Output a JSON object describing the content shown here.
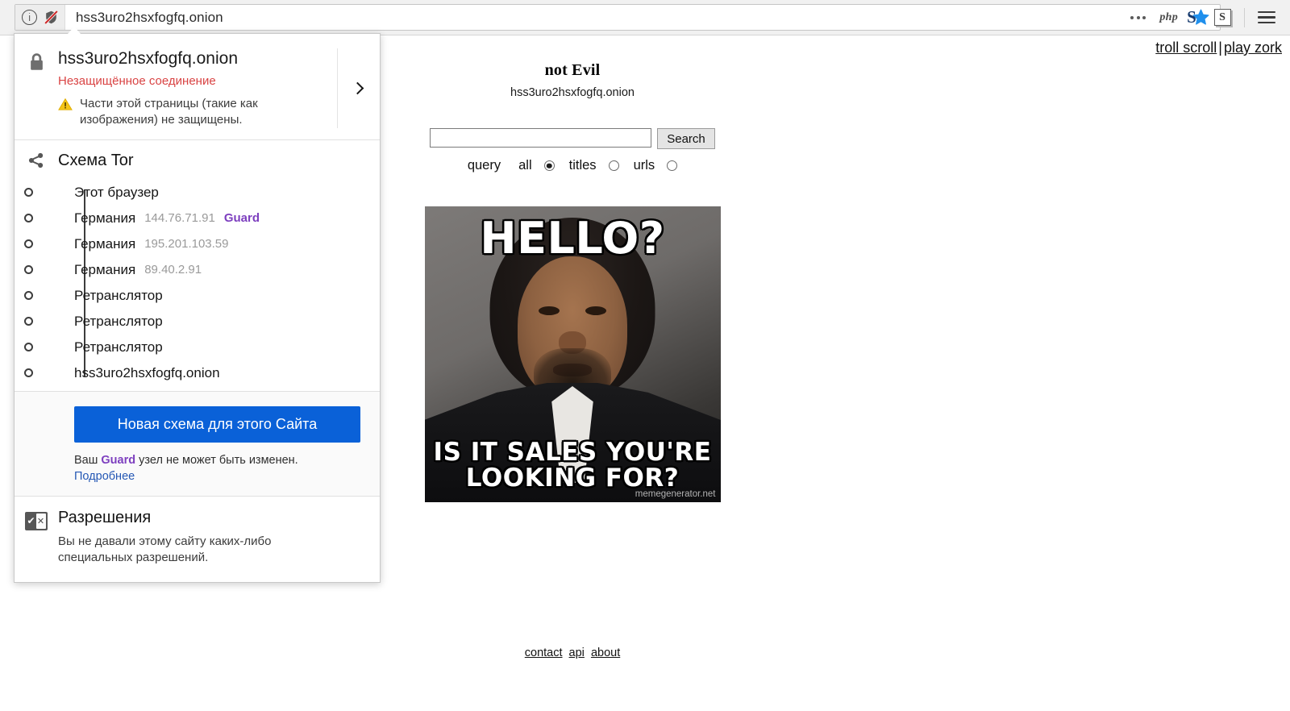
{
  "browser": {
    "url": "hss3uro2hsxfogfq.onion",
    "identity_icon": "info-circle-icon",
    "mixed_content_icon": "shield-slash-icon",
    "overflow_icon": "ellipsis-icon",
    "php_addon_label": "php",
    "bookmark_icon": "star-icon",
    "extension_1_label": "S",
    "extension_2_label": "S",
    "menu_icon": "hamburger-menu-icon"
  },
  "identity_popup": {
    "host": "hss3uro2hsxfogfq.onion",
    "connection_status": "Незащищённое соединение",
    "warning_text": "Части этой страницы (такие как изображения) не защищены.",
    "lock_icon": "lock-icon",
    "warning_icon": "warning-triangle-icon",
    "expand_icon": "chevron-right-icon",
    "tor": {
      "title": "Схема Tor",
      "icon": "share-nodes-icon",
      "nodes": [
        {
          "name": "Этот браузер",
          "ip": "",
          "badge": ""
        },
        {
          "name": "Германия",
          "ip": "144.76.71.91",
          "badge": "Guard"
        },
        {
          "name": "Германия",
          "ip": "195.201.103.59",
          "badge": ""
        },
        {
          "name": "Германия",
          "ip": "89.40.2.91",
          "badge": ""
        },
        {
          "name": "Ретранслятор",
          "ip": "",
          "badge": ""
        },
        {
          "name": "Ретранслятор",
          "ip": "",
          "badge": ""
        },
        {
          "name": "Ретранслятор",
          "ip": "",
          "badge": ""
        },
        {
          "name": "hss3uro2hsxfogfq.onion",
          "ip": "",
          "badge": ""
        }
      ],
      "new_circuit_button": "Новая схема для этого Сайта",
      "guard_note_prefix": "Ваш ",
      "guard_note_badge": "Guard",
      "guard_note_suffix": " узел не может быть изменен.",
      "learn_more": "Подробнее"
    },
    "permissions": {
      "icon": "permissions-icon",
      "title": "Разрешения",
      "text": "Вы не давали этому сайту каких-либо специальных разрешений."
    }
  },
  "page": {
    "corner_links": [
      {
        "label": "troll scroll"
      },
      {
        "label": "play zork"
      }
    ],
    "corner_separator": "|",
    "title": "not Evil",
    "subtitle": "hss3uro2hsxfogfq.onion",
    "search": {
      "value": "",
      "placeholder": "",
      "button_label": "Search"
    },
    "scope": {
      "label": "query",
      "options": [
        {
          "label": "all",
          "checked": true
        },
        {
          "label": "titles",
          "checked": false
        },
        {
          "label": "urls",
          "checked": false
        }
      ]
    },
    "meme": {
      "top_text": "HELLO?",
      "bottom_text": "IS IT SALES YOU'RE LOOKING FOR?",
      "watermark": "memegenerator.net"
    },
    "footer_links": [
      {
        "label": "contact"
      },
      {
        "label": "api"
      },
      {
        "label": "about"
      }
    ]
  }
}
